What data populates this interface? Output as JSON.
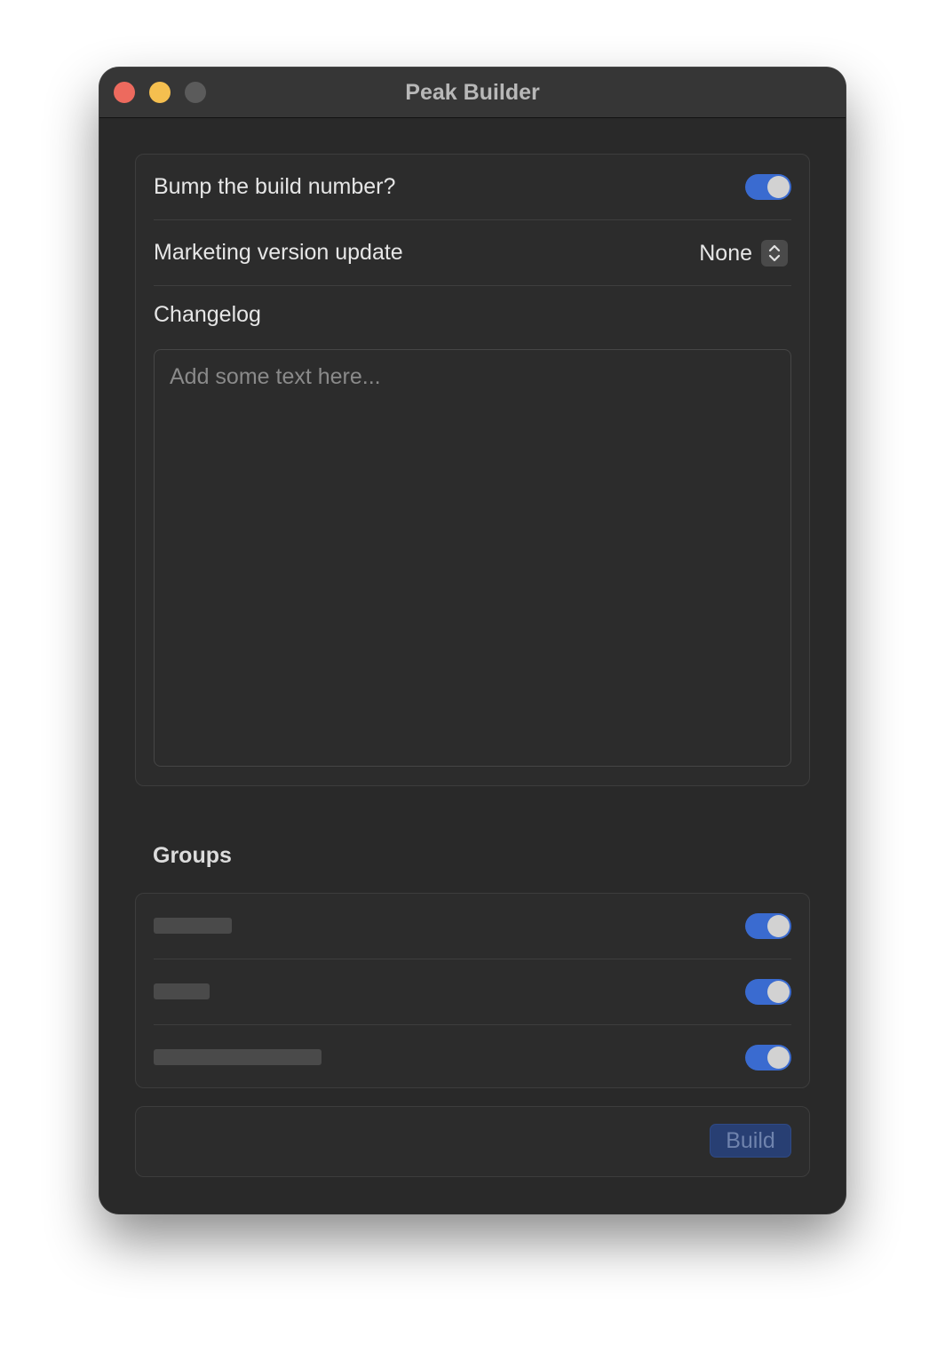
{
  "window": {
    "title": "Peak Builder"
  },
  "settings": {
    "bump_build_label": "Bump the build number?",
    "bump_build_enabled": true,
    "marketing_label": "Marketing version update",
    "marketing_value": "None",
    "changelog_label": "Changelog",
    "changelog_placeholder": "Add some text here...",
    "changelog_value": ""
  },
  "groups": {
    "heading": "Groups",
    "items": [
      {
        "enabled": true
      },
      {
        "enabled": true
      },
      {
        "enabled": true
      }
    ]
  },
  "actions": {
    "build_label": "Build",
    "build_enabled": false
  },
  "colors": {
    "accent": "#3a6bd0",
    "window_bg": "#292929",
    "titlebar_bg": "#363636",
    "close": "#ed6a5e",
    "minimize": "#f5bf4f",
    "zoom_inactive": "#5b5b5b"
  },
  "icons": {
    "popup_indicator": "chevron-up-down-icon"
  }
}
